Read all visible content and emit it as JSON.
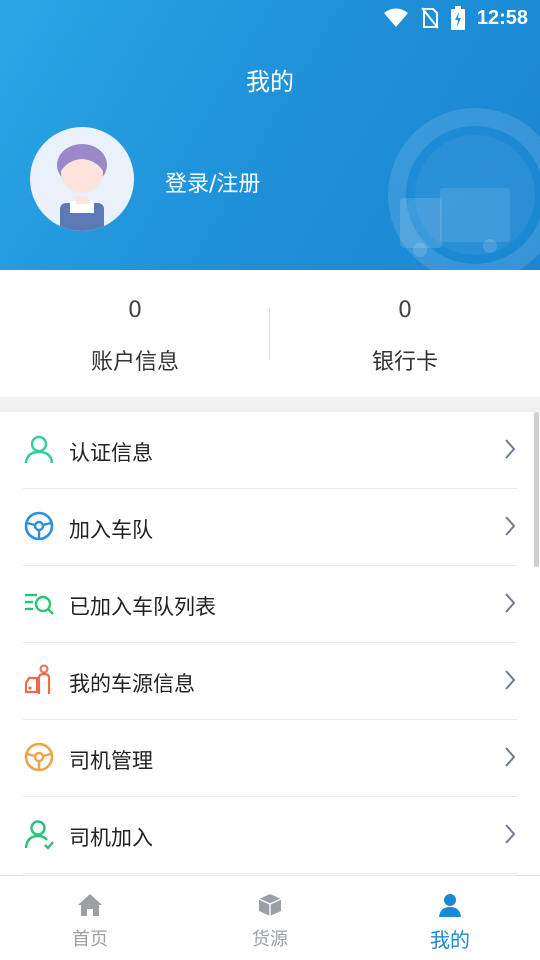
{
  "status_bar": {
    "time": "12:58",
    "icons": [
      "wifi-icon",
      "no-sim-icon",
      "battery-charging-icon"
    ]
  },
  "header": {
    "title": "我的",
    "login_label": "登录/注册",
    "background_color": "#1e8fd8"
  },
  "stats": [
    {
      "value": "0",
      "label": "账户信息"
    },
    {
      "value": "0",
      "label": "银行卡"
    }
  ],
  "menu": [
    {
      "label": "认证信息",
      "icon": "user-verify-icon",
      "color": "#2ecf9a"
    },
    {
      "label": "加入车队",
      "icon": "steering-wheel-icon",
      "color": "#2a8fde"
    },
    {
      "label": "已加入车队列表",
      "icon": "list-search-icon",
      "color": "#28c27a"
    },
    {
      "label": "我的车源信息",
      "icon": "car-person-icon",
      "color": "#ef6a4c"
    },
    {
      "label": "司机管理",
      "icon": "steering-wheel-icon",
      "color": "#f2a147"
    },
    {
      "label": "司机加入",
      "icon": "person-add-icon",
      "color": "#28c27a"
    }
  ],
  "tabbar": [
    {
      "label": "首页",
      "icon": "home-icon",
      "active": false
    },
    {
      "label": "货源",
      "icon": "package-icon",
      "active": false
    },
    {
      "label": "我的",
      "icon": "profile-icon",
      "active": true
    }
  ],
  "colors": {
    "accent": "#1b8ad4",
    "inactive": "#9aa0a6"
  }
}
